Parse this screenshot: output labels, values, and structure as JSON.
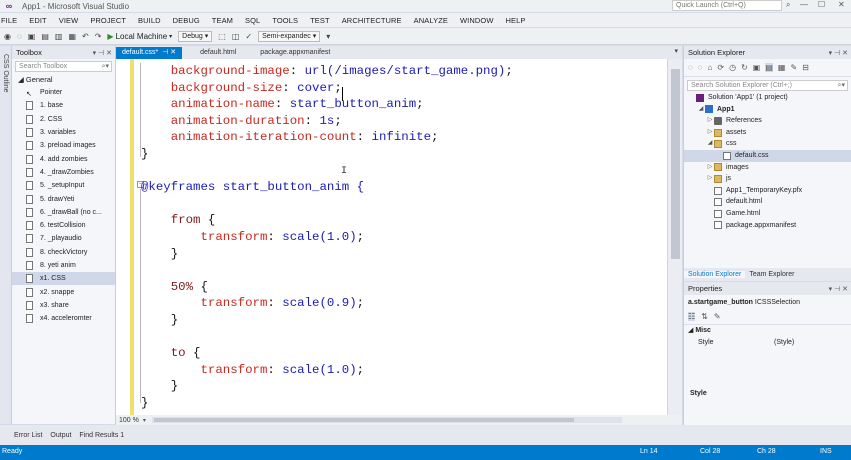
{
  "window": {
    "title": "App1 - Microsoft Visual Studio",
    "quick_launch_placeholder": "Quick Launch (Ctrl+Q)"
  },
  "menu": [
    "FILE",
    "EDIT",
    "VIEW",
    "PROJECT",
    "BUILD",
    "DEBUG",
    "TEAM",
    "SQL",
    "TOOLS",
    "TEST",
    "ARCHITECTURE",
    "ANALYZE",
    "WINDOW",
    "HELP"
  ],
  "toolbar": {
    "run_target": "Local Machine",
    "configuration": "Debug",
    "selection_mode": "Semi-expandec"
  },
  "side_strip_label": "CSS Outline",
  "toolbox": {
    "title": "Toolbox",
    "search_placeholder": "Search Toolbox",
    "group": "General",
    "items": [
      "Pointer",
      "1. base",
      "2. CSS",
      "3. variables",
      "3. preload images",
      "4. add zombies",
      "4. _drawZombies",
      "5. _setupInput",
      "5. drawYeti",
      "6. _drawBall (no c...",
      "6. testCollision",
      "7. _playaudio",
      "8. checkVictory",
      "8. yeti anim",
      "x1. CSS",
      "x2. snappe",
      "x3. share",
      "x4. acceleromter"
    ],
    "selected_index": 14
  },
  "editor": {
    "tabs": [
      {
        "label": "default.css*",
        "active": true
      },
      {
        "label": "default.html",
        "active": false
      },
      {
        "label": "package.appxmanifest",
        "active": false
      }
    ],
    "zoom": "100 %",
    "code": {
      "l1_prop": "background-image",
      "l1_val": " url(/images/start_game.png)",
      "l2_prop": "background-size",
      "l2_val": " cover",
      "l3_prop": "animation-name",
      "l3_val": " start_button_anim",
      "l4_prop": "animation-duration",
      "l4_val": " 1s",
      "l5_prop": "animation-iteration-count",
      "l5_val": " infinite",
      "keyframes_at": "@keyframes",
      "keyframes_name": " start_button_anim {",
      "from_sel": "from",
      "transform_prop": "transform",
      "scale_1": " scale(1.0)",
      "mid_sel": "50%",
      "scale_09": " scale(0.9)",
      "to_sel": "to"
    }
  },
  "bottom_tabs": [
    "Error List",
    "Output",
    "Find Results 1"
  ],
  "status": {
    "text": "Ready",
    "ln": "Ln 14",
    "col": "Col 28",
    "ch": "Ch 28",
    "mode": "INS"
  },
  "solution_explorer": {
    "title": "Solution Explorer",
    "search_placeholder": "Search Solution Explorer (Ctrl+;)",
    "tree": [
      {
        "label": "Solution 'App1' (1 project)",
        "icon": "solution-icon",
        "indent": 0,
        "exp": ""
      },
      {
        "label": "App1",
        "icon": "project-icon",
        "indent": 1,
        "exp": "◢",
        "bold": true
      },
      {
        "label": "References",
        "icon": "references-icon",
        "indent": 2,
        "exp": "▷"
      },
      {
        "label": "assets",
        "icon": "folder-icon",
        "indent": 2,
        "exp": "▷"
      },
      {
        "label": "css",
        "icon": "folder-icon",
        "indent": 2,
        "exp": "◢"
      },
      {
        "label": "default.css",
        "icon": "file-icon",
        "indent": 3,
        "exp": "",
        "selected": true
      },
      {
        "label": "images",
        "icon": "folder-icon",
        "indent": 2,
        "exp": "▷"
      },
      {
        "label": "js",
        "icon": "folder-icon",
        "indent": 2,
        "exp": "▷"
      },
      {
        "label": "App1_TemporaryKey.pfx",
        "icon": "file-icon",
        "indent": 2,
        "exp": ""
      },
      {
        "label": "default.html",
        "icon": "file-icon",
        "indent": 2,
        "exp": ""
      },
      {
        "label": "Game.html",
        "icon": "file-icon",
        "indent": 2,
        "exp": ""
      },
      {
        "label": "package.appxmanifest",
        "icon": "file-icon",
        "indent": 2,
        "exp": ""
      }
    ],
    "tabs": [
      {
        "label": "Solution Explorer",
        "active": true
      },
      {
        "label": "Team Explorer",
        "active": false
      }
    ]
  },
  "properties": {
    "title": "Properties",
    "target_name": "a.startgame_button",
    "target_type": "ICSSSelection",
    "category": "Misc",
    "row_key": "Style",
    "row_value": "(Style)",
    "description": "Style"
  },
  "colors": {
    "accent": "#007acc",
    "selection_highlight": "#aec9e6",
    "css_property": "#c8281e",
    "css_value": "#1b1bb5"
  }
}
